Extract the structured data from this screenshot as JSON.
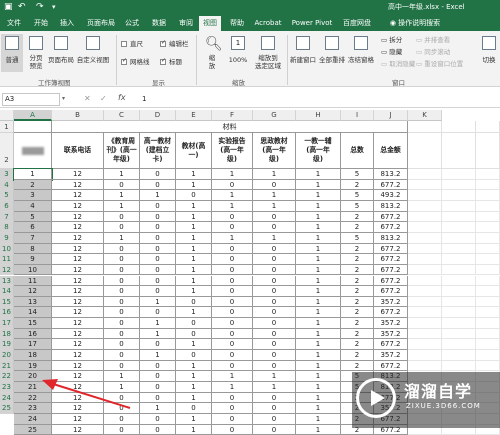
{
  "window": {
    "filename": "高中一年级.xlsx - Excel"
  },
  "tabs": [
    "文件",
    "开始",
    "插入",
    "页面布局",
    "公式",
    "数据",
    "审阅",
    "视图",
    "帮助",
    "Acrobat",
    "Power Pivot",
    "百度网盘"
  ],
  "tell_me": "操作说明搜索",
  "ribbon": {
    "normal": "普通",
    "page_break": "分页\n预览",
    "page_layout": "页面布局",
    "custom_view": "自定义视图",
    "group_views": "工作簿视图",
    "ruler": "直尺",
    "formula_bar": "编辑栏",
    "gridlines": "网格线",
    "headings": "标题",
    "group_show": "显示",
    "zoom": "缩\n放",
    "zoom100": "100%",
    "zoom_sel": "缩放到\n选定区域",
    "group_zoom": "缩放",
    "new_window": "新建窗口",
    "arrange_all": "全部重排",
    "freeze": "冻结窗格",
    "split": "拆分",
    "hide": "隐藏",
    "unhide": "取消隐藏",
    "side_by_side": "并排查看",
    "sync_scroll": "同步滚动",
    "reset_pos": "重设窗口位置",
    "switch": "切换",
    "group_window": "窗口"
  },
  "formula_bar": {
    "name_box": "A3",
    "fx": "fx",
    "value": "1"
  },
  "columns": [
    "A",
    "B",
    "C",
    "D",
    "E",
    "F",
    "G",
    "H",
    "I",
    "J",
    "K"
  ],
  "sheet": {
    "title": "材料",
    "headers": [
      "",
      "联系电话",
      "《教育周\n刊》(高一\n年级)",
      "高一教材\n(建档立\n卡)",
      "教材(高\n一)",
      "实验报告\n(高一年\n级)",
      "思政教材\n(高一年\n级)",
      "一教一辅\n(高一年\n级)",
      "总数",
      "总金额"
    ],
    "rows": [
      [
        "1",
        "12",
        "1",
        "0",
        "1",
        "1",
        "1",
        "1",
        "5",
        "813.2"
      ],
      [
        "2",
        "12",
        "0",
        "0",
        "1",
        "0",
        "0",
        "1",
        "2",
        "677.2"
      ],
      [
        "3",
        "12",
        "1",
        "1",
        "0",
        "1",
        "1",
        "1",
        "5",
        "493.2"
      ],
      [
        "4",
        "12",
        "1",
        "0",
        "1",
        "1",
        "1",
        "1",
        "5",
        "813.2"
      ],
      [
        "5",
        "12",
        "0",
        "0",
        "1",
        "0",
        "0",
        "1",
        "2",
        "677.2"
      ],
      [
        "6",
        "12",
        "0",
        "0",
        "1",
        "0",
        "0",
        "1",
        "2",
        "677.2"
      ],
      [
        "7",
        "12",
        "1",
        "0",
        "1",
        "1",
        "1",
        "1",
        "5",
        "813.2"
      ],
      [
        "8",
        "12",
        "0",
        "0",
        "1",
        "0",
        "0",
        "1",
        "2",
        "677.2"
      ],
      [
        "9",
        "12",
        "0",
        "0",
        "1",
        "0",
        "0",
        "1",
        "2",
        "677.2"
      ],
      [
        "10",
        "12",
        "0",
        "0",
        "1",
        "0",
        "0",
        "1",
        "2",
        "677.2"
      ],
      [
        "11",
        "12",
        "0",
        "0",
        "1",
        "0",
        "0",
        "1",
        "2",
        "677.2"
      ],
      [
        "12",
        "12",
        "0",
        "0",
        "1",
        "0",
        "0",
        "1",
        "2",
        "677.2"
      ],
      [
        "13",
        "12",
        "0",
        "1",
        "0",
        "0",
        "0",
        "1",
        "2",
        "357.2"
      ],
      [
        "14",
        "12",
        "0",
        "0",
        "1",
        "0",
        "0",
        "1",
        "2",
        "677.2"
      ],
      [
        "15",
        "12",
        "0",
        "1",
        "0",
        "0",
        "0",
        "1",
        "2",
        "357.2"
      ],
      [
        "16",
        "12",
        "0",
        "1",
        "0",
        "0",
        "0",
        "1",
        "2",
        "357.2"
      ],
      [
        "17",
        "12",
        "0",
        "0",
        "1",
        "0",
        "0",
        "1",
        "2",
        "677.2"
      ],
      [
        "18",
        "12",
        "0",
        "1",
        "0",
        "0",
        "0",
        "1",
        "2",
        "357.2"
      ],
      [
        "19",
        "12",
        "0",
        "0",
        "1",
        "0",
        "0",
        "1",
        "2",
        "677.2"
      ],
      [
        "20",
        "12",
        "1",
        "0",
        "1",
        "1",
        "1",
        "1",
        "5",
        "813.2"
      ],
      [
        "21",
        "12",
        "1",
        "0",
        "1",
        "1",
        "1",
        "1",
        "5",
        "813.2"
      ],
      [
        "22",
        "12",
        "0",
        "0",
        "1",
        "0",
        "0",
        "1",
        "2",
        "677.2"
      ],
      [
        "23",
        "12",
        "0",
        "1",
        "0",
        "0",
        "0",
        "1",
        "2",
        "357.2"
      ],
      [
        "24",
        "12",
        "0",
        "0",
        "1",
        "0",
        "0",
        "1",
        "2",
        "677.2"
      ],
      [
        "25",
        "12",
        "0",
        "0",
        "1",
        "0",
        "0",
        "1",
        "2",
        "677.2"
      ]
    ]
  },
  "row_numbers": [
    "1",
    "2",
    "3",
    "4",
    "5",
    "6",
    "7",
    "8",
    "9",
    "10",
    "11",
    "12",
    "13",
    "14",
    "15",
    "16",
    "17",
    "18",
    "19",
    "20",
    "21",
    "22",
    "23",
    "24",
    "25"
  ],
  "watermark": {
    "brand": "溜溜自学",
    "site": "ZIXUE.3D66.COM"
  },
  "colors": {
    "accent": "#217346",
    "arrow": "#e0262b"
  }
}
